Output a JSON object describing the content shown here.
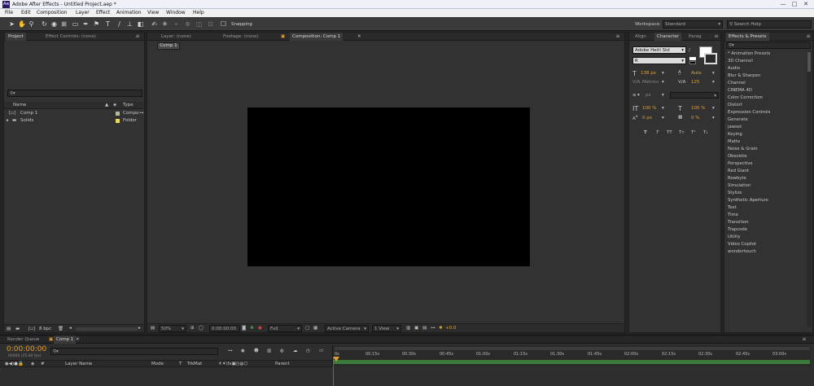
{
  "window": {
    "title": "Adobe After Effects - Untitled Project.aep *",
    "app_icon": "Ae",
    "minimize": "—",
    "maximize": "□",
    "close": "✕"
  },
  "menu": [
    "File",
    "Edit",
    "Composition",
    "Layer",
    "Effect",
    "Animation",
    "View",
    "Window",
    "Help"
  ],
  "toolbar": {
    "snapping_label": "Snapping",
    "workspace_label": "Workspace:",
    "workspace_value": "Standard",
    "search_placeholder": "Search Help"
  },
  "project_panel": {
    "tab_project": "Project",
    "tab_effect_controls": "Effect Controls: (none)",
    "search_placeholder": "",
    "col_name": "Name",
    "col_type": "Type",
    "items": [
      {
        "name": "Comp 1",
        "type": "Compo",
        "label_color": "#b8b8a0"
      },
      {
        "name": "Solids",
        "type": "Folder",
        "label_color": "#e8d860"
      }
    ],
    "bpc": "8 bpc"
  },
  "viewer": {
    "tab_layer": "Layer: (none)",
    "tab_footage": "Footage: (none)",
    "tab_comp": "Composition: Comp 1",
    "comp_chip": "Comp 1",
    "zoom": "50%",
    "timecode": "0:00:00:00",
    "resolution": "Full",
    "camera": "Active Camera",
    "views": "1 View",
    "exposure": "+0.0",
    "canvas_color": "#000000"
  },
  "character_panel": {
    "tab_align": "Align",
    "tab_character": "Character",
    "tab_paragraph": "Parag",
    "font": "Adobe Heiti Std",
    "style": "R",
    "size": "138 px",
    "leading": "Auto",
    "kerning": "Metrics",
    "tracking": "125",
    "stroke_unit": "px",
    "vscale": "100 %",
    "hscale": "100 %",
    "baseline": "0 px",
    "tsume": "0 %",
    "format_buttons": [
      "T",
      "T",
      "TT",
      "Tт",
      "T¹",
      "T₁"
    ]
  },
  "effects_panel": {
    "title": "Effects & Presets",
    "search_value": "",
    "items": [
      "* Animation Presets",
      "3D Channel",
      "Audio",
      "Blur & Sharpen",
      "Channel",
      "CINEMA 4D",
      "Color Correction",
      "Distort",
      "Expression Controls",
      "Generate",
      "jawset",
      "Keying",
      "Matte",
      "Noise & Grain",
      "Obsolete",
      "Perspective",
      "Red Giant",
      "Rowbyte",
      "Simulation",
      "Stylize",
      "Synthetic Aperture",
      "Text",
      "Time",
      "Transition",
      "Trapcode",
      "Utility",
      "Video Copilot",
      "wondertouch"
    ]
  },
  "timeline": {
    "tab_render_queue": "Render Queue",
    "tab_comp": "Comp 1",
    "timecode": "0:00:00:00",
    "timecode_sub": "00000 (25.00 fps)",
    "col_layer_name": "Layer Name",
    "col_mode": "Mode",
    "col_t": "T",
    "col_trkmat": "TrkMat",
    "col_parent": "Parent",
    "ruler": [
      "0s",
      "00:15s",
      "00:30s",
      "00:45s",
      "01:00s",
      "01:15s",
      "01:30s",
      "01:45s",
      "02:00s",
      "02:15s",
      "02:30s",
      "02:45s",
      "03:00s"
    ]
  },
  "colors": {
    "accent_orange": "#e0a030",
    "panel_bg": "#323232",
    "timeline_green": "#3c7a3c"
  }
}
